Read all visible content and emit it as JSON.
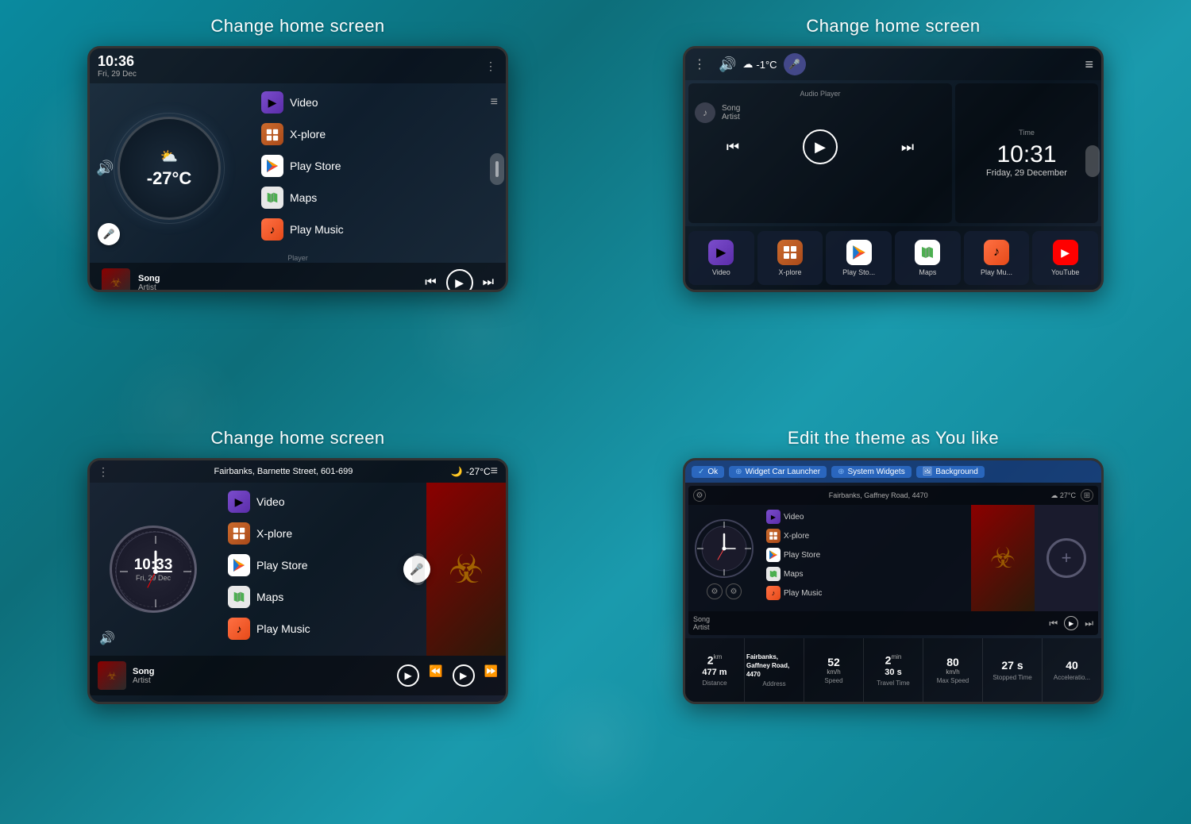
{
  "cells": [
    {
      "id": "cell1",
      "title": "Change home screen",
      "phone": {
        "topbar": {
          "time": "10:36",
          "date": "Fri, 29 Dec",
          "dots": "⋮"
        },
        "temperature": "-27°C",
        "apps": [
          {
            "id": "video",
            "label": "Video"
          },
          {
            "id": "xplore",
            "label": "X-plore"
          },
          {
            "id": "playstore",
            "label": "Play Store"
          },
          {
            "id": "maps",
            "label": "Maps"
          },
          {
            "id": "playmusic",
            "label": "Play Music"
          }
        ],
        "player": {
          "label": "Player",
          "song": "Song",
          "artist": "Artist"
        }
      }
    },
    {
      "id": "cell2",
      "title": "Change home screen",
      "phone": {
        "topbar": {
          "dots": "⋮",
          "temp": "-1°C"
        },
        "audio_widget": {
          "title": "Audio Player",
          "song": "Song",
          "artist": "Artist"
        },
        "time_widget": {
          "title": "Time",
          "time": "10:31",
          "date": "Friday, 29 December"
        },
        "apps": [
          {
            "id": "video",
            "label": "Video"
          },
          {
            "id": "xplore",
            "label": "X-plore"
          },
          {
            "id": "playstore",
            "label": "Play Sto..."
          },
          {
            "id": "maps",
            "label": "Maps"
          },
          {
            "id": "playmusic",
            "label": "Play Mu..."
          },
          {
            "id": "youtube",
            "label": "YouTube"
          }
        ]
      }
    },
    {
      "id": "cell3",
      "title": "Change home screen",
      "phone": {
        "topbar": {
          "dots": "⋮",
          "address": "Fairbanks, Barnette Street, 601-699",
          "temp": "-27°C"
        },
        "clock": {
          "time": "10:33",
          "date": "Fri, 29 Dec"
        },
        "apps": [
          {
            "id": "video",
            "label": "Video"
          },
          {
            "id": "xplore",
            "label": "X-plore"
          },
          {
            "id": "playstore",
            "label": "Play Store"
          },
          {
            "id": "maps",
            "label": "Maps"
          },
          {
            "id": "playmusic",
            "label": "Play Music"
          }
        ],
        "player": {
          "song": "Song",
          "artist": "Artist"
        }
      }
    },
    {
      "id": "cell4",
      "title": "Edit the theme as You like",
      "phone": {
        "tabs": [
          {
            "label": "Ok",
            "has_check": true
          },
          {
            "label": "Widget Car Launcher",
            "has_plus": true
          },
          {
            "label": "System Widgets",
            "has_plus": true
          },
          {
            "label": "Background",
            "has_icon": true
          }
        ],
        "inner_top": {
          "address": "Fairbanks, Gaffney Road, 4470",
          "temp": "27°C"
        },
        "apps": [
          {
            "id": "video",
            "label": "Video"
          },
          {
            "id": "xplore",
            "label": "X-plore"
          },
          {
            "id": "playstore",
            "label": "Play Store"
          },
          {
            "id": "maps",
            "label": "Maps"
          },
          {
            "id": "playmusic",
            "label": "Play Music"
          }
        ],
        "player": {
          "song": "Song",
          "artist": "Artist"
        },
        "stats": [
          {
            "value": "2",
            "superscript": "km",
            "value2": "477 m",
            "label": "Distance"
          },
          {
            "value": "Fairbanks, Gaffney Road, 4470",
            "label": "Address"
          },
          {
            "value": "52",
            "unit": "km/h",
            "label": "Speed"
          },
          {
            "value": "2",
            "unit": "min",
            "value2": "30 s",
            "label": "Travel Time"
          },
          {
            "value": "80",
            "unit": "km/h",
            "label": "Max Speed"
          },
          {
            "value": "27 s",
            "label": "Stopped Time"
          },
          {
            "value": "40",
            "label": "Acceleratio..."
          }
        ]
      }
    }
  ]
}
